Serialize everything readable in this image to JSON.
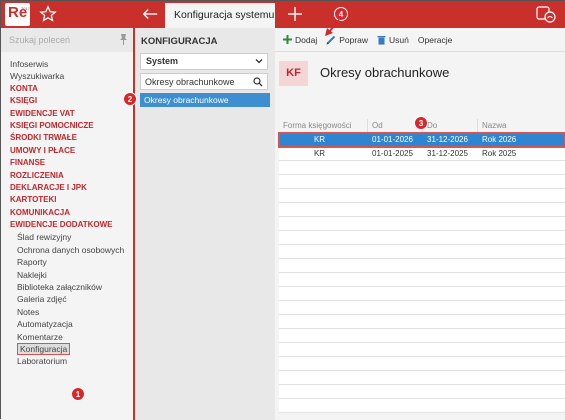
{
  "app": {
    "logo_text": "Re",
    "logo_sup": "2017"
  },
  "tabs": [
    {
      "label": "Konfiguracja systemu",
      "active": true
    }
  ],
  "sidebar": {
    "search_placeholder": "Szukaj poleceń",
    "items": [
      {
        "label": "Infoserwis",
        "style": "plain"
      },
      {
        "label": "Wyszukiwarka",
        "style": "plain"
      },
      {
        "label": "KONTA",
        "style": "red"
      },
      {
        "label": "KSIĘGI",
        "style": "red"
      },
      {
        "label": "EWIDENCJE VAT",
        "style": "red"
      },
      {
        "label": "KSIĘGI POMOCNICZE",
        "style": "red"
      },
      {
        "label": "ŚRODKI TRWAŁE",
        "style": "red"
      },
      {
        "label": "UMOWY I PŁACE",
        "style": "red"
      },
      {
        "label": "FINANSE",
        "style": "red"
      },
      {
        "label": "ROZLICZENIA",
        "style": "red"
      },
      {
        "label": "DEKLARACJE I JPK",
        "style": "red"
      },
      {
        "label": "KARTOTEKI",
        "style": "red"
      },
      {
        "label": "KOMUNIKACJA",
        "style": "red"
      },
      {
        "label": "EWIDENCJE DODATKOWE",
        "style": "red"
      },
      {
        "label": "Ślad rewizyjny",
        "style": "sub"
      },
      {
        "label": "Ochrona danych osobowych",
        "style": "sub"
      },
      {
        "label": "Raporty",
        "style": "sub"
      },
      {
        "label": "Naklejki",
        "style": "sub"
      },
      {
        "label": "Biblioteka załączników",
        "style": "sub"
      },
      {
        "label": "Galeria zdjęć",
        "style": "sub"
      },
      {
        "label": "Notes",
        "style": "sub"
      },
      {
        "label": "Automatyzacja",
        "style": "sub"
      },
      {
        "label": "Komentarze",
        "style": "sub"
      },
      {
        "label": "Konfiguracja",
        "style": "sub",
        "selected": true
      },
      {
        "label": "Laboratorium",
        "style": "sub"
      }
    ]
  },
  "middle": {
    "title": "KONFIGURACJA",
    "select_value": "System",
    "search_value": "Okresy obrachunkowe",
    "selected_item": "Okresy obrachunkowe"
  },
  "toolbar": {
    "add_label": "Dodaj",
    "edit_label": "Popraw",
    "delete_label": "Usuń",
    "operations_label": "Operacje"
  },
  "page": {
    "badge": "KF",
    "title": "Okresy obrachunkowe"
  },
  "table": {
    "headers": [
      "Forma księgowości",
      "Od",
      "Do",
      "Nazwa"
    ],
    "rows": [
      {
        "forma": "KR",
        "od": "01-01-2026",
        "do": "31-12-2026",
        "nazwa": "Rok 2026",
        "selected": true
      },
      {
        "forma": "KR",
        "od": "01-01-2025",
        "do": "31-12-2025",
        "nazwa": "Rok 2025",
        "selected": false
      }
    ]
  },
  "callouts": [
    "1",
    "2",
    "3",
    "4"
  ],
  "colors": {
    "brand": "#c9302c",
    "selection": "#2f86d0",
    "callout": "#d9262b"
  }
}
